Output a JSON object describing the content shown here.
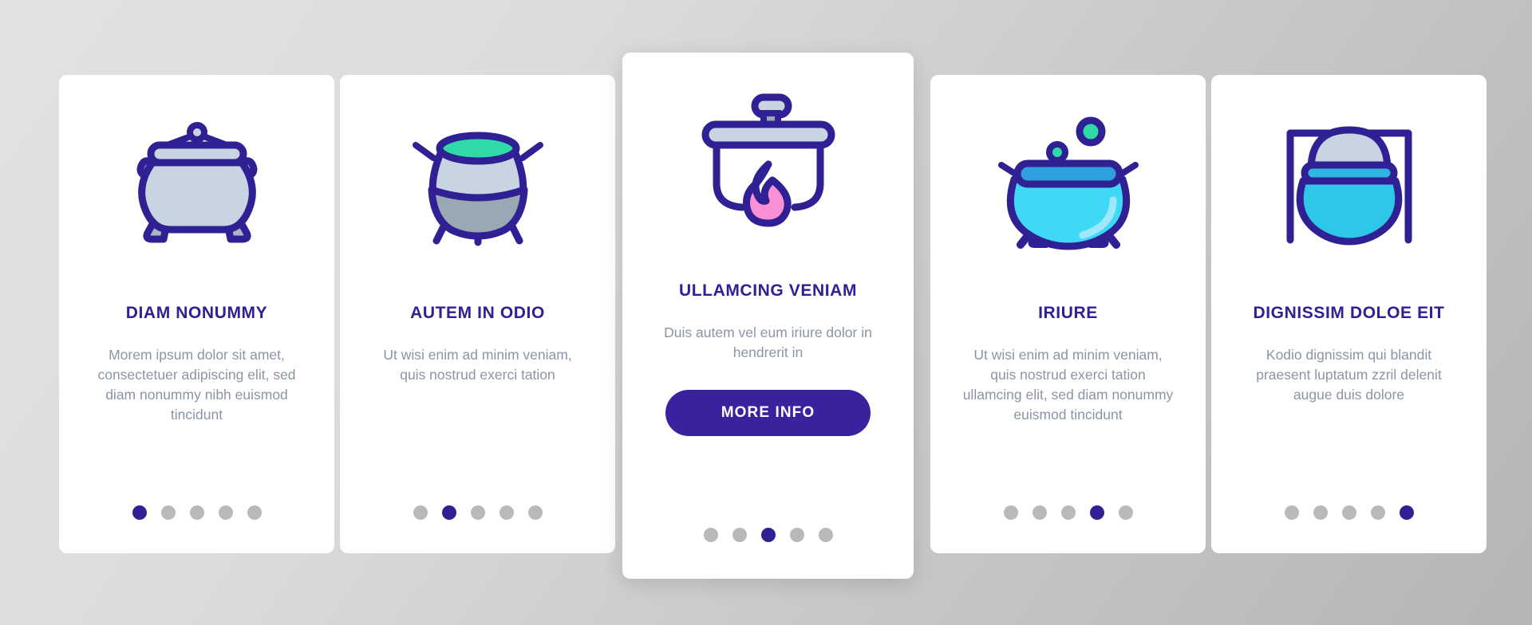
{
  "theme": {
    "primary": "#2f2093",
    "button": "#3a219e",
    "dot_inactive": "#b9b9b9",
    "body_text": "#8b95a5",
    "card_bg": "#ffffff",
    "page_bg": "#cccccc"
  },
  "cards": [
    {
      "icon": "cauldron-with-lid-icon",
      "title": "DIAM NONUMMY",
      "description": "Morem ipsum dolor sit amet, consectetuer adipiscing elit, sed diam nonummy nibh euismod tincidunt",
      "dots": {
        "count": 5,
        "active": 1
      }
    },
    {
      "icon": "cauldron-green-brew-icon",
      "title": "AUTEM IN ODIO",
      "description": "Ut wisi enim ad minim veniam, quis nostrud exerci tation",
      "dots": {
        "count": 5,
        "active": 2
      }
    },
    {
      "icon": "pot-on-fire-icon",
      "title": "ULLAMCING VENIAM",
      "description": "Duis autem vel eum iriure dolor in hendrerit in",
      "button_label": "MORE INFO",
      "dots": {
        "count": 5,
        "active": 3
      }
    },
    {
      "icon": "bubbling-cauldron-icon",
      "title": "IRIURE",
      "description": "Ut wisi enim ad minim veniam, quis nostrud exerci tation ullamcing elit, sed diam nonummy euismod tincidunt",
      "dots": {
        "count": 5,
        "active": 4
      }
    },
    {
      "icon": "hanging-cauldron-icon",
      "title": "DIGNISSIM DOLOE EIT",
      "description": "Kodio dignissim qui blandit praesent luptatum zzril delenit augue duis dolore",
      "dots": {
        "count": 5,
        "active": 5
      }
    }
  ]
}
